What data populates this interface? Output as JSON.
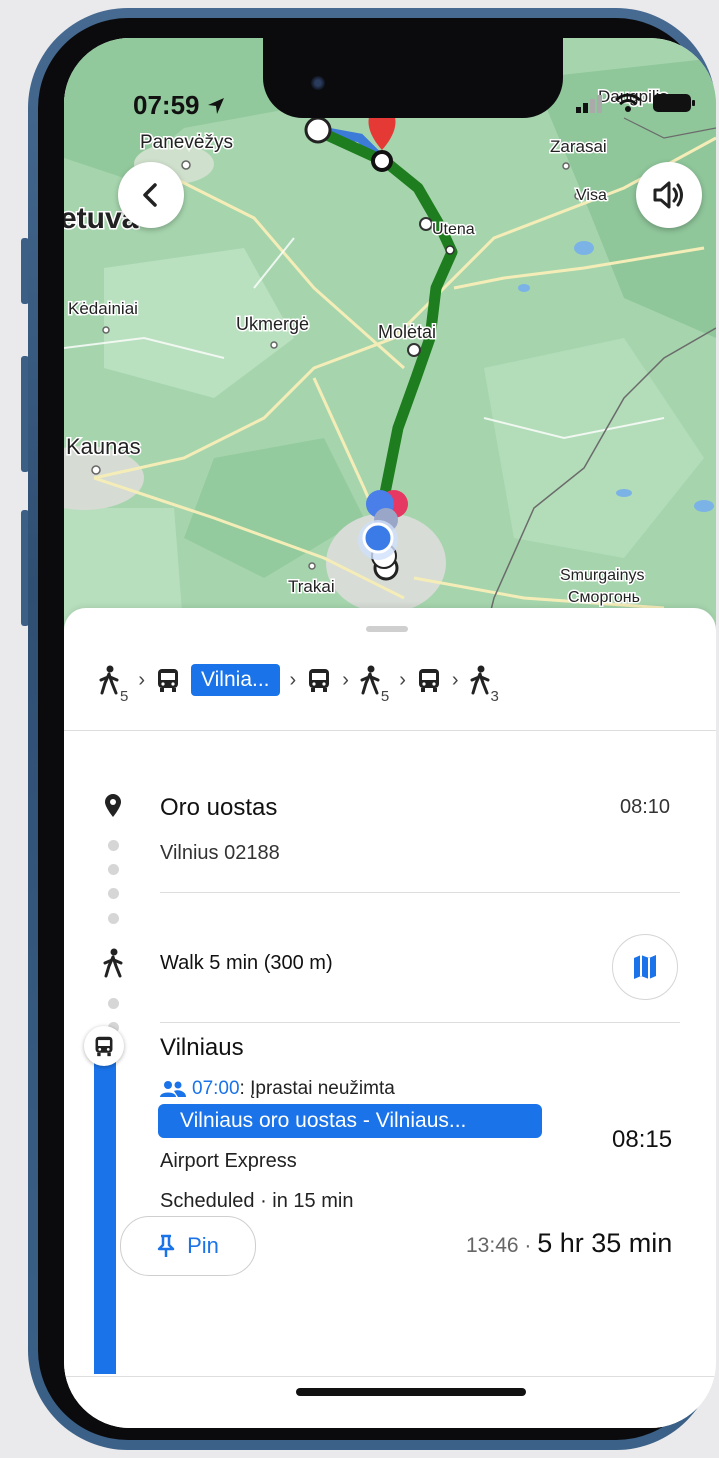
{
  "status_bar": {
    "time": "07:59"
  },
  "map": {
    "places": [
      {
        "name": "Panevėžys"
      },
      {
        "name": "Zarasai"
      },
      {
        "name": "Daugpilis"
      },
      {
        "name": "Visa"
      },
      {
        "name": "Utena"
      },
      {
        "name": "Kėdainiai"
      },
      {
        "name": "Ukmergė"
      },
      {
        "name": "Molėtai"
      },
      {
        "name": "Kaunas"
      },
      {
        "name": "Trakai"
      },
      {
        "name": "Smurgainys"
      },
      {
        "name": "Сморгонь"
      },
      {
        "name": "etuva"
      }
    ]
  },
  "steps": {
    "walk1_minutes": "5",
    "route_label": "Vilnia...",
    "walk2_minutes": "5",
    "walk3_minutes": "3"
  },
  "stop1": {
    "name": "Oro uostas",
    "address": "Vilnius 02188",
    "time": "08:10"
  },
  "walk": {
    "label": "Walk 5 min (300 m)"
  },
  "transit": {
    "stop_name": "Vilniaus",
    "crowd_time": "07:00",
    "crowd_text": ": Įprastai neužimta",
    "route_name": "Vilniaus oro uostas - Vilniaus...",
    "operator": "Airport Express",
    "schedule": "Scheduled · in 15 min",
    "departure": "08:15"
  },
  "footer": {
    "pin_label": "Pin",
    "arrival": "13:46",
    "separator": " · ",
    "duration": "5 hr 35 min"
  },
  "colors": {
    "accent": "#1a73e8",
    "route_green": "#1e7d1e",
    "map_green": "#a7d7b0",
    "destination_red": "#e53935"
  }
}
